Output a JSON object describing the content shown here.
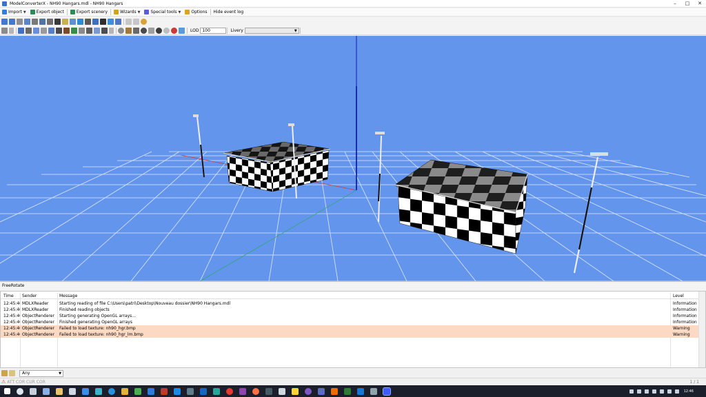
{
  "window": {
    "title": "ModelConverterX - NH90 Hangars.mdl - NH90 Hangars",
    "controls": [
      "–",
      "□",
      "✕"
    ]
  },
  "menu": {
    "import": "Import",
    "export_object": "Export object",
    "export_scenery": "Export scenery",
    "wizards": "Wizards",
    "special_tools": "Special tools",
    "options": "Options",
    "hide_event_log": "Hide event log"
  },
  "toolbar": {
    "lod_label": "LOD",
    "lod_value": "100",
    "livery_label": "Livery",
    "livery_value": ""
  },
  "viewport": {
    "mode": "FreeRotate",
    "colors": {
      "background": "#6495ed",
      "grid": "#dfe8fb"
    }
  },
  "event_log": {
    "columns": {
      "time": "Time",
      "sender": "Sender",
      "message": "Message",
      "level": "Level"
    },
    "rows": [
      {
        "time": "12:45:40",
        "sender": "MDLXReader",
        "message": "Starting reading of file C:\\Users\\patri\\Desktop\\Nouveau dossier\\NH90 Hangars.mdl",
        "level": "Information"
      },
      {
        "time": "12:45:40",
        "sender": "MDLXReader",
        "message": "Finished reading objects",
        "level": "Information"
      },
      {
        "time": "12:45:40",
        "sender": "ObjectRenderer",
        "message": "Starting generating OpenGL arrays...",
        "level": "Information"
      },
      {
        "time": "12:45:40",
        "sender": "ObjectRenderer",
        "message": "Finished generating OpenGL arrays",
        "level": "Information"
      },
      {
        "time": "12:45:40",
        "sender": "ObjectRenderer",
        "message": "Failed to load texture: nh90_hgr.bmp",
        "level": "Warning"
      },
      {
        "time": "12:45:40",
        "sender": "ObjectRenderer",
        "message": "Failed to load texture: nh90_hgr_lm.bmp",
        "level": "Warning"
      }
    ],
    "filter_value": "Any",
    "colors": {
      "warning_row": "#fbd9c3"
    }
  },
  "status": {
    "left_text": "ATT COR  CUR COR",
    "page": "1 / 1"
  },
  "taskbar": {
    "clock": "12:46"
  }
}
